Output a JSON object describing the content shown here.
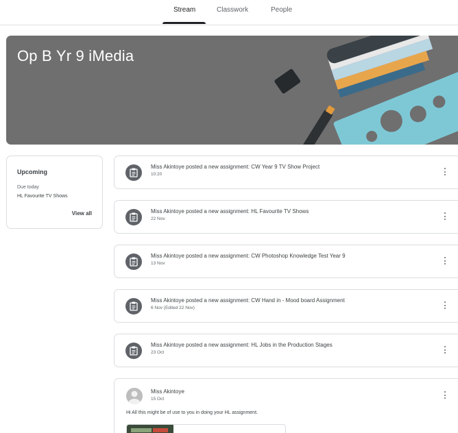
{
  "nav": {
    "tabs": [
      {
        "label": "Stream",
        "active": true
      },
      {
        "label": "Classwork",
        "active": false
      },
      {
        "label": "People",
        "active": false
      }
    ]
  },
  "banner": {
    "title": "Op B Yr 9 iMedia",
    "color": "#6f6f6f"
  },
  "upcoming": {
    "title": "Upcoming",
    "due_label": "Due today",
    "item": "HL Favourite TV Shows",
    "view_all": "View all"
  },
  "posts": [
    {
      "title": "Miss Akintoye posted a new assignment: CW Year 9 TV Show Project",
      "date": "10:20",
      "icon": "assignment-icon"
    },
    {
      "title": "Miss Akintoye posted a new assignment: HL Favourite TV Shows",
      "date": "22 Nov",
      "icon": "assignment-icon"
    },
    {
      "title": "Miss Akintoye posted a new assignment: CW Photoshop Knowledge Test Year 9",
      "date": "13 Nov",
      "icon": "assignment-icon"
    },
    {
      "title": "Miss Akintoye posted a new assignment: CW Hand in - Mood board Assignment",
      "date": "6 Nov (Edited 22 Nov)",
      "icon": "assignment-icon"
    },
    {
      "title": "Miss Akintoye posted a new assignment: HL Jobs in the Production Stages",
      "date": "23 Oct",
      "icon": "assignment-icon"
    }
  ],
  "announcement": {
    "author": "Miss Akintoye",
    "date": "15 Oct",
    "text": "Hi All  this might be of use to you in doing your HL assignment."
  }
}
